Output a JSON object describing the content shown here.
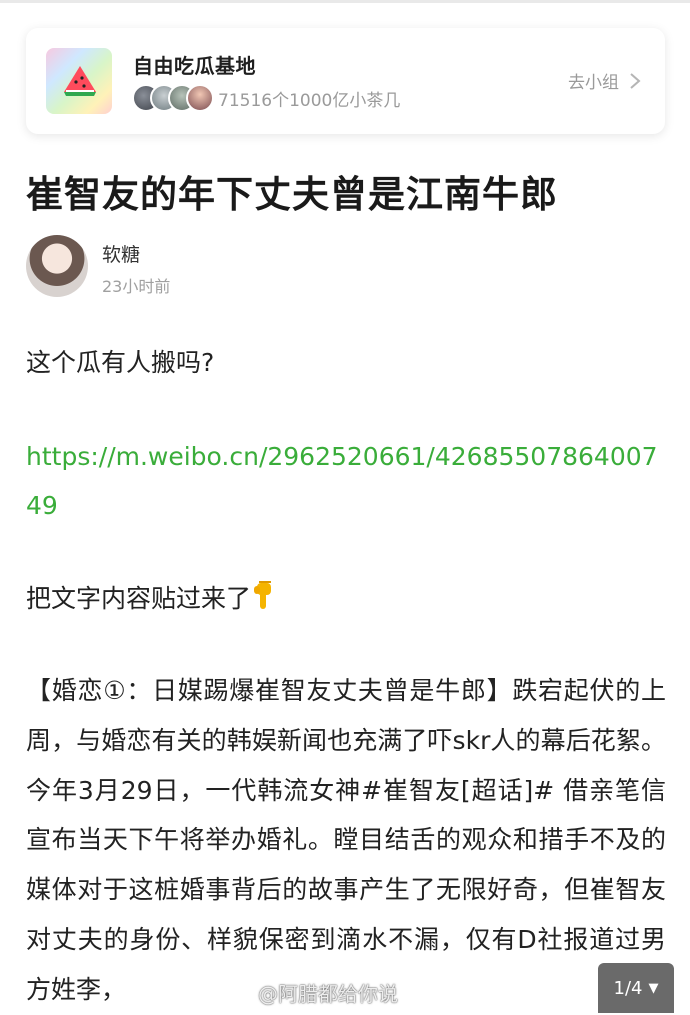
{
  "group": {
    "name": "自由吃瓜基地",
    "members_text": "71516个1000亿小茶几",
    "go_label": "去小组"
  },
  "post": {
    "title": "崔智友的年下丈夫曾是江南牛郎",
    "author": "软糖",
    "time": "23小时前",
    "question": "这个瓜有人搬吗?",
    "link": "https://m.weibo.cn/2962520661/4268550786400749",
    "paste_note": "把文字内容贴过来了",
    "body": "【婚恋①：日媒踢爆崔智友丈夫曾是牛郎】跌宕起伏的上周，与婚恋有关的韩娱新闻也充满了吓skr人的幕后花絮。今年3月29日，一代韩流女神#崔智友[超话]# 借亲笔信宣布当天下午将举办婚礼。瞠目结舌的观众和措手不及的媒体对于这桩婚事背后的故事产生了无限好奇，但崔智友对丈夫的身份、样貌保密到滴水不漏，仅有D社报道过男方姓李，"
  },
  "watermark": "@阿腊都给你说",
  "pager": {
    "label": "1/4",
    "caret": "▼"
  },
  "icons": {
    "logo": "watermelon-icon",
    "chevron": "chevron-right-icon",
    "emoji": "pointing-down-emoji"
  },
  "colors": {
    "link": "#3aad3a",
    "muted": "#9a9a9a",
    "pager_bg": "#6a6a6a"
  }
}
